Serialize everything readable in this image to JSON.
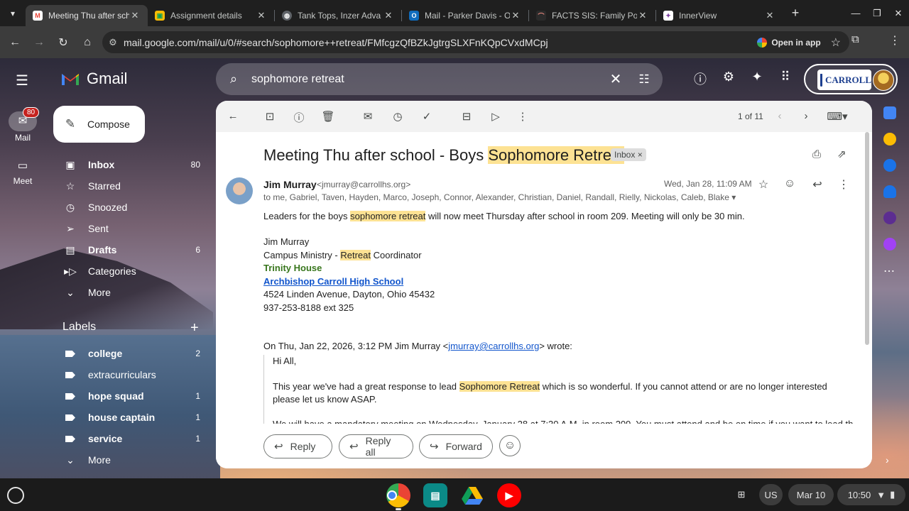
{
  "browser": {
    "tabs": [
      {
        "title": "Meeting Thu after scho",
        "active": true,
        "icon": "gmail-icon"
      },
      {
        "title": "Assignment details",
        "active": false,
        "icon": "classroom-icon"
      },
      {
        "title": "Tank Tops, Inzer Adva",
        "active": false,
        "icon": "globe-icon"
      },
      {
        "title": "Mail - Parker Davis - O",
        "active": false,
        "icon": "outlook-icon"
      },
      {
        "title": "FACTS SIS: Family Por",
        "active": false,
        "icon": "facts-icon"
      },
      {
        "title": "InnerView",
        "active": false,
        "icon": "innerview-icon"
      }
    ],
    "url": "mail.google.com/mail/u/0/#search/sophomore++retreat/FMfcgzQfBZkJgtrgSLXFnKQpCVxdMCpj",
    "open_in_app": "Open in app"
  },
  "gmail": {
    "brand": "Gmail",
    "search_value": "sophomore  retreat",
    "account_org": "CARROLL",
    "rail": [
      {
        "label": "Mail",
        "badge": "80"
      },
      {
        "label": "Meet"
      }
    ],
    "compose": "Compose",
    "nav": [
      {
        "label": "Inbox",
        "count": "80",
        "icon": "inbox-icon",
        "bold": true
      },
      {
        "label": "Starred",
        "count": "",
        "icon": "star-icon",
        "bold": false
      },
      {
        "label": "Snoozed",
        "count": "",
        "icon": "clock-icon",
        "bold": false
      },
      {
        "label": "Sent",
        "count": "",
        "icon": "send-icon",
        "bold": false
      },
      {
        "label": "Drafts",
        "count": "6",
        "icon": "draft-icon",
        "bold": true
      },
      {
        "label": "Categories",
        "count": "",
        "icon": "label-icon",
        "bold": false
      },
      {
        "label": "More",
        "count": "",
        "icon": "chevron-down-icon",
        "bold": false
      }
    ],
    "labels_heading": "Labels",
    "labels": [
      {
        "label": "college",
        "count": "2",
        "bold": true
      },
      {
        "label": "extracurriculars",
        "count": "",
        "bold": false
      },
      {
        "label": "hope squad",
        "count": "1",
        "bold": true
      },
      {
        "label": "house captain",
        "count": "1",
        "bold": true
      },
      {
        "label": "service",
        "count": "1",
        "bold": true
      },
      {
        "label": "More",
        "count": "",
        "bold": false
      }
    ]
  },
  "email": {
    "pager": "1 of 11",
    "subject_pre": "Meeting Thu after school - Boys ",
    "subject_hl": "Sophomore Retreat",
    "inbox_chip": "Inbox",
    "sender_name": "Jim Murray",
    "sender_email": "<jmurray@carrollhs.org>",
    "recipients": "to me, Gabriel, Taven, Hayden, Marco, Joseph, Connor, Alexander, Christian, Daniel, Randall, Rielly, Nickolas, Caleb, Blake",
    "date": "Wed, Jan 28, 11:09 AM",
    "body_pre": "Leaders for the boys ",
    "body_hl": "sophomore retreat",
    "body_post": " will now meet Thursday after school in room 209. Meeting will only be 30 min.",
    "sig_name": "Jim Murray",
    "sig_role_pre": "Campus Ministry - ",
    "sig_role_hl": "Retreat",
    "sig_role_post": " Coordinator",
    "sig_house": "Trinity House",
    "sig_school": "Archbishop Carroll High School",
    "sig_address": "4524 Linden Avenue, Dayton, Ohio 45432",
    "sig_phone": "937-253-8188  ext 325",
    "quote_header_pre": "On Thu, Jan 22, 2026, 3:12 PM Jim Murray <",
    "quote_header_link": "jmurray@carrollhs.org",
    "quote_header_post": "> wrote:",
    "quote_greeting": "Hi All,",
    "quote_p1_pre": "This year we've had a great response to lead ",
    "quote_p1_hl": "Sophomore Retreat",
    "quote_p1_post": " which is so wonderful.  If you cannot attend or are no longer interested please let us know ASAP.",
    "quote_p2": "We will have a mandatory meeting on Wednesday, January 28 at 7:30 A.M. in room 209.  You must attend and be on time if you want to lead the",
    "reply": "Reply",
    "reply_all": "Reply all",
    "forward": "Forward"
  },
  "shelf": {
    "ime": "US",
    "date": "Mar 10",
    "time": "10:50"
  },
  "colors": {
    "highlight": "#fde293",
    "green_sig": "#38761d",
    "link": "#1155cc",
    "badge_red": "#c5221f"
  }
}
